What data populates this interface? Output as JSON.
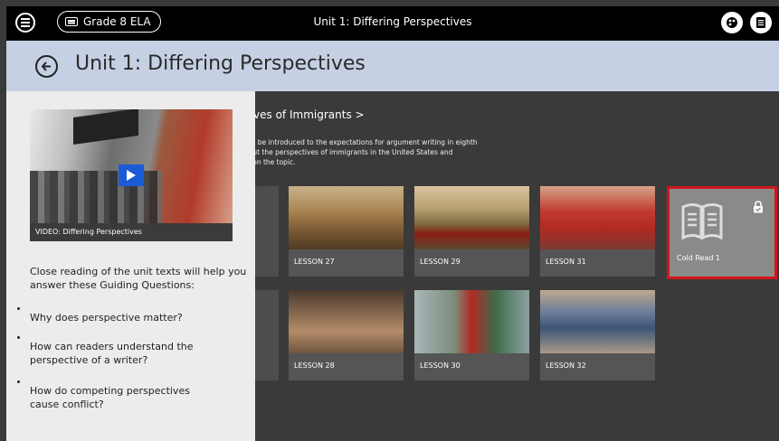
{
  "topbar": {
    "grade_label": "Grade 8 ELA",
    "title": "Unit 1: Differing Perspectives"
  },
  "header": {
    "title": "Unit 1: Differing Perspectives"
  },
  "sidebar": {
    "video_caption": "VIDEO: Differing Perspectives",
    "intro": "Close reading of the unit texts will help you answer these Guiding Questions:",
    "questions": [
      "Why does perspective matter?",
      "How can readers understand the perspective of a writer?",
      "How do competing perspectives cause conflict?"
    ]
  },
  "section": {
    "title": "tives of Immigrants >",
    "description_lines": [
      "will be introduced to the expectations for argument writing in eighth",
      "bout the perspectives of immigrants in the United States and",
      "ts on the topic."
    ]
  },
  "lessons": [
    {
      "label": "LESSON 27"
    },
    {
      "label": "LESSON 29"
    },
    {
      "label": "LESSON 31"
    },
    {
      "label": "LESSON 28"
    },
    {
      "label": "LESSON 30"
    },
    {
      "label": "LESSON 32"
    }
  ],
  "cold_read": {
    "label": "Cold Read 1",
    "highlight_color": "#d3141b"
  },
  "colors": {
    "topbar": "#000000",
    "header": "#c6d0e4",
    "content_bg": "#3a3a3a",
    "sidebar_bg": "#ececec",
    "play_button": "#1a5bd6"
  }
}
